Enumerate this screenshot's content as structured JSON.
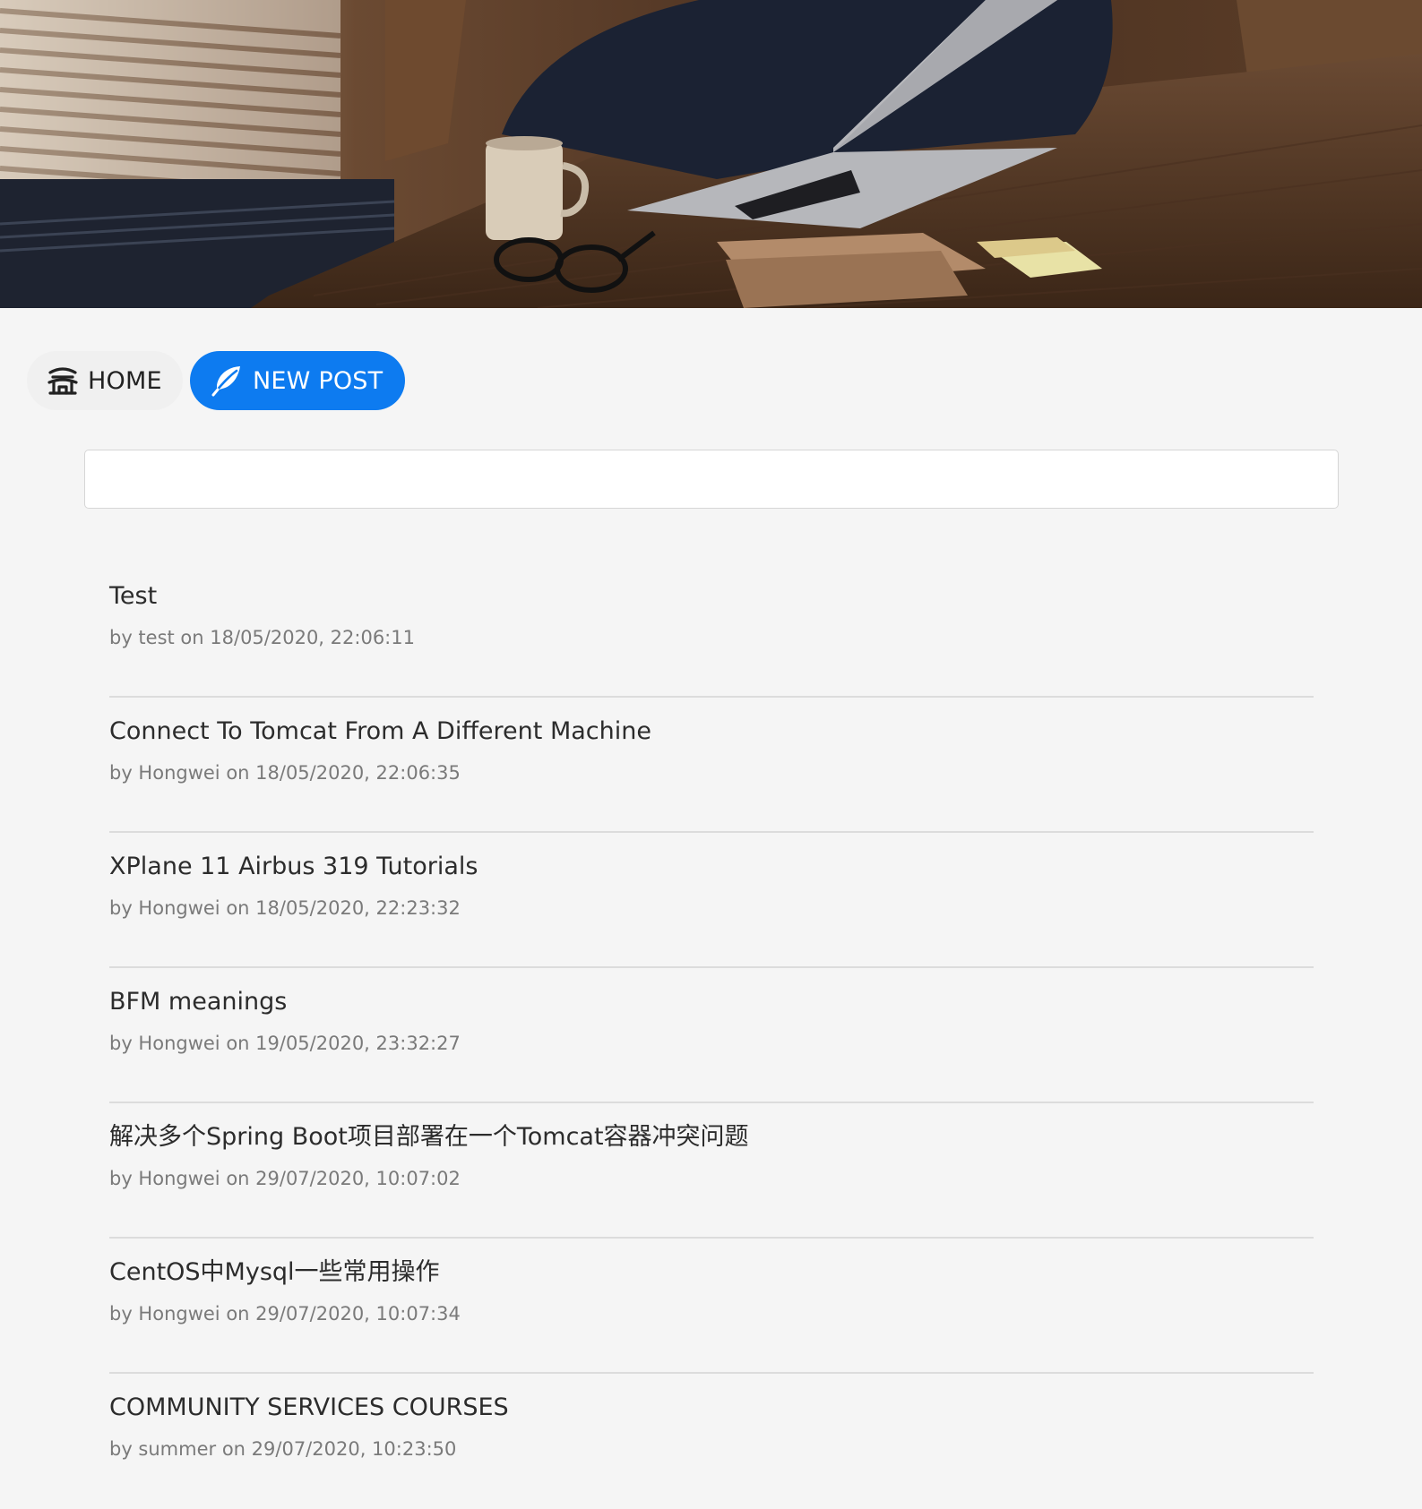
{
  "nav": {
    "home_label": "HOME",
    "new_post_label": "NEW POST",
    "home_icon": "pagoda-home-icon",
    "new_post_icon": "feather-icon",
    "accent_color": "#0d7bf0"
  },
  "search": {
    "value": "",
    "placeholder": ""
  },
  "posts": [
    {
      "title": "Test",
      "meta": "by test on 18/05/2020, 22:06:11"
    },
    {
      "title": "Connect To Tomcat From A Different Machine",
      "meta": "by Hongwei on 18/05/2020, 22:06:35"
    },
    {
      "title": "XPlane 11 Airbus 319 Tutorials",
      "meta": "by Hongwei on 18/05/2020, 22:23:32"
    },
    {
      "title": "BFM meanings",
      "meta": "by Hongwei on 19/05/2020, 23:32:27"
    },
    {
      "title": "解决多个Spring Boot项目部署在一个Tomcat容器冲突问题",
      "meta": "by Hongwei on 29/07/2020, 10:07:02"
    },
    {
      "title": "CentOS中Mysql一些常用操作",
      "meta": "by Hongwei on 29/07/2020, 10:07:34"
    },
    {
      "title": "COMMUNITY SERVICES COURSES",
      "meta": "by summer on 29/07/2020, 10:23:50"
    }
  ]
}
